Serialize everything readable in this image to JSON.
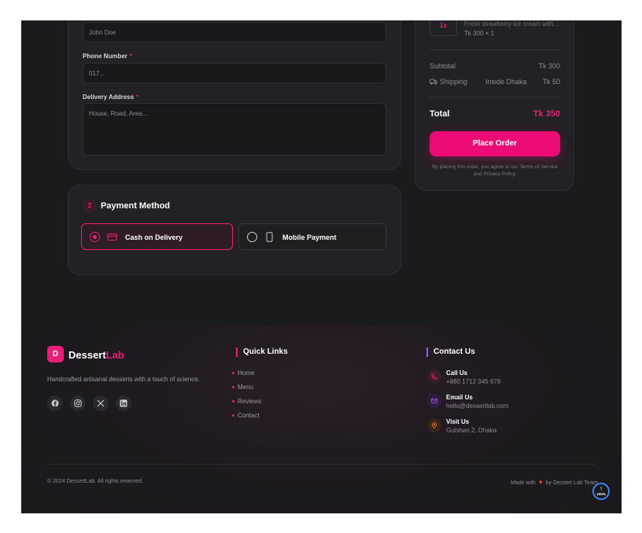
{
  "form": {
    "name_value": "John Doe",
    "phone_label": "Phone Number",
    "phone_required": "*",
    "phone_placeholder": "017...",
    "address_label": "Delivery Address",
    "address_required": "*",
    "address_placeholder": "House, Road, Area..."
  },
  "summary": {
    "item_qty": "1x",
    "item_desc": "Fresh strawberry ice cream with...",
    "item_price": "Tk 300 × 1",
    "subtotal_label": "Subtotal",
    "subtotal_value": "Tk 300",
    "shipping_label": "Shipping",
    "shipping_zone": "Inside Dhaka",
    "shipping_value": "Tk 50",
    "total_label": "Total",
    "total_value": "Tk 350",
    "place_order": "Place Order",
    "terms": "By placing this order, you agree to our Terms of Service and Privacy Policy."
  },
  "payment": {
    "step": "2",
    "title": "Payment Method",
    "options": [
      {
        "label": "Cash on Delivery",
        "icon": "card-icon",
        "selected": true
      },
      {
        "label": "Mobile Payment",
        "icon": "phone-icon",
        "selected": false
      }
    ]
  },
  "footer": {
    "logo_letter": "D",
    "brand_main": "Dessert",
    "brand_accent": "Lab",
    "tagline": "Handcrafted artisanal desserts with a touch of science.",
    "socials": [
      "facebook-icon",
      "instagram-icon",
      "x-icon",
      "linkedin-icon"
    ],
    "quick_links_title": "Quick Links",
    "quick_links": [
      "Home",
      "Menu",
      "Reviews",
      "Contact"
    ],
    "contact_title": "Contact Us",
    "contacts": [
      {
        "label": "Call Us",
        "value": "+880 1712 345 678",
        "icon": "phone-icon",
        "color": "#ec1f78"
      },
      {
        "label": "Email Us",
        "value": "hello@dessertlab.com",
        "icon": "mail-icon",
        "color": "#a855f7"
      },
      {
        "label": "Visit Us",
        "value": "Gulshan 2, Dhaka",
        "icon": "map-pin-icon",
        "color": "#f97316"
      }
    ],
    "copyright": "© 2024 DessertLab. All rights reserved.",
    "made_with_prefix": "Made with",
    "made_with_suffix": "by Dessert Lab Team",
    "scroll_percent": "100%"
  },
  "colors": {
    "accent": "#ec1f78",
    "background": "#1b1a1d",
    "card": "#222125"
  }
}
